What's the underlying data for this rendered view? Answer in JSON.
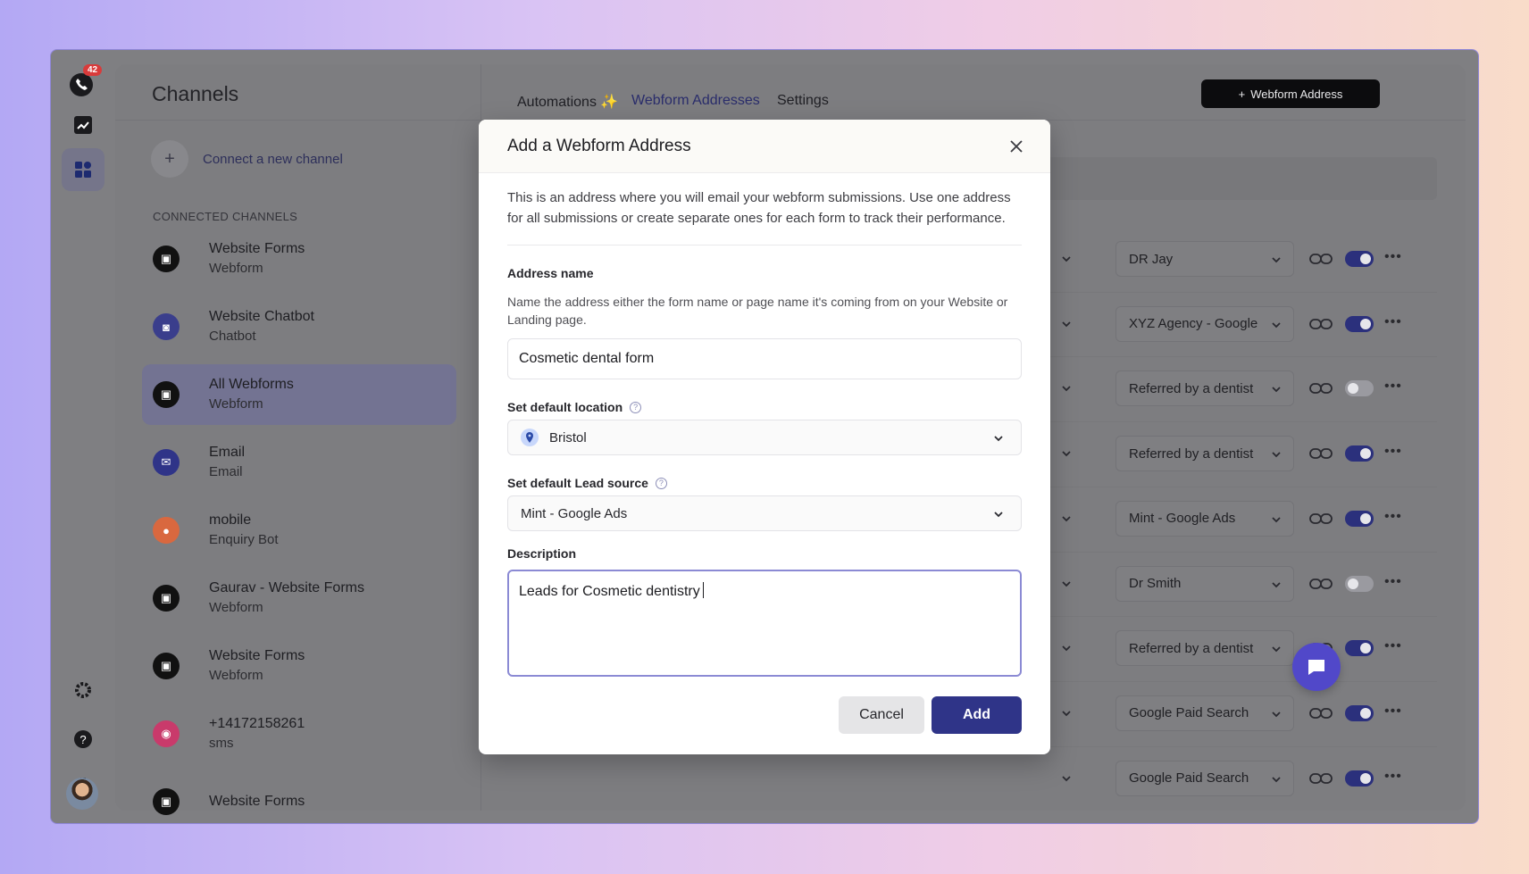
{
  "rail": {
    "badge_count": "42",
    "icons": [
      "chat-logo-icon",
      "analytics-icon",
      "apps-grid-icon",
      "gear-icon",
      "help-icon",
      "trash-icon"
    ]
  },
  "channels": {
    "title": "Channels",
    "connect_label": "Connect a new channel",
    "section_label": "CONNECTED CHANNELS",
    "items": [
      {
        "name": "Website Forms",
        "type": "Webform",
        "icon_color": "#111111"
      },
      {
        "name": "Website Chatbot",
        "type": "Chatbot",
        "icon_color": "#3a3e8c"
      },
      {
        "name": "All Webforms",
        "type": "Webform",
        "icon_color": "#111111"
      },
      {
        "name": "Email",
        "type": "Email",
        "icon_color": "#2f3488"
      },
      {
        "name": "mobile",
        "type": "Enquiry Bot",
        "icon_color": "#d9683f"
      },
      {
        "name": "Gaurav - Website Forms",
        "type": "Webform",
        "icon_color": "#111111"
      },
      {
        "name": "Website Forms",
        "type": "Webform",
        "icon_color": "#111111"
      },
      {
        "name": "+14172158261",
        "type": "sms",
        "icon_color": "#c93a6b"
      },
      {
        "name": "Website Forms",
        "type": "",
        "icon_color": "#111111"
      }
    ]
  },
  "tabs": [
    {
      "label": "Automations ✨"
    },
    {
      "label": "Webform Addresses"
    },
    {
      "label": "Settings"
    }
  ],
  "header": {
    "add_button_label": "Webform Address"
  },
  "rows": [
    {
      "source": "DR Jay",
      "enabled": true
    },
    {
      "source": "XYZ Agency - Google",
      "enabled": true
    },
    {
      "source": "Referred by a dentist",
      "enabled": false
    },
    {
      "source": "Referred by a dentist",
      "enabled": true
    },
    {
      "source": "Mint - Google Ads",
      "enabled": true
    },
    {
      "source": "Dr Smith",
      "enabled": false
    },
    {
      "source": "Referred by a dentist",
      "enabled": true
    },
    {
      "source": "Google Paid Search",
      "enabled": true
    },
    {
      "source": "Google Paid Search",
      "enabled": true
    }
  ],
  "modal": {
    "title": "Add a Webform Address",
    "description": "This is an address where you will email your webform submissions. Use one address for all submissions or create separate ones for each form to track their performance.",
    "address_name_label": "Address name",
    "address_name_help": "Name the address either the form name or page name it's coming from on your Website or Landing page.",
    "address_name_value": "Cosmetic dental form",
    "location_label": "Set default location",
    "location_value": "Bristol",
    "lead_source_label": "Set default Lead source",
    "lead_source_value": "Mint - Google Ads",
    "description_label": "Description",
    "description_value": "Leads for Cosmetic dentistry",
    "cancel_label": "Cancel",
    "add_label": "Add"
  },
  "colors": {
    "accent": "#2f3488",
    "toggle_on": "#2b307c",
    "chat_fab": "#5148c9"
  }
}
